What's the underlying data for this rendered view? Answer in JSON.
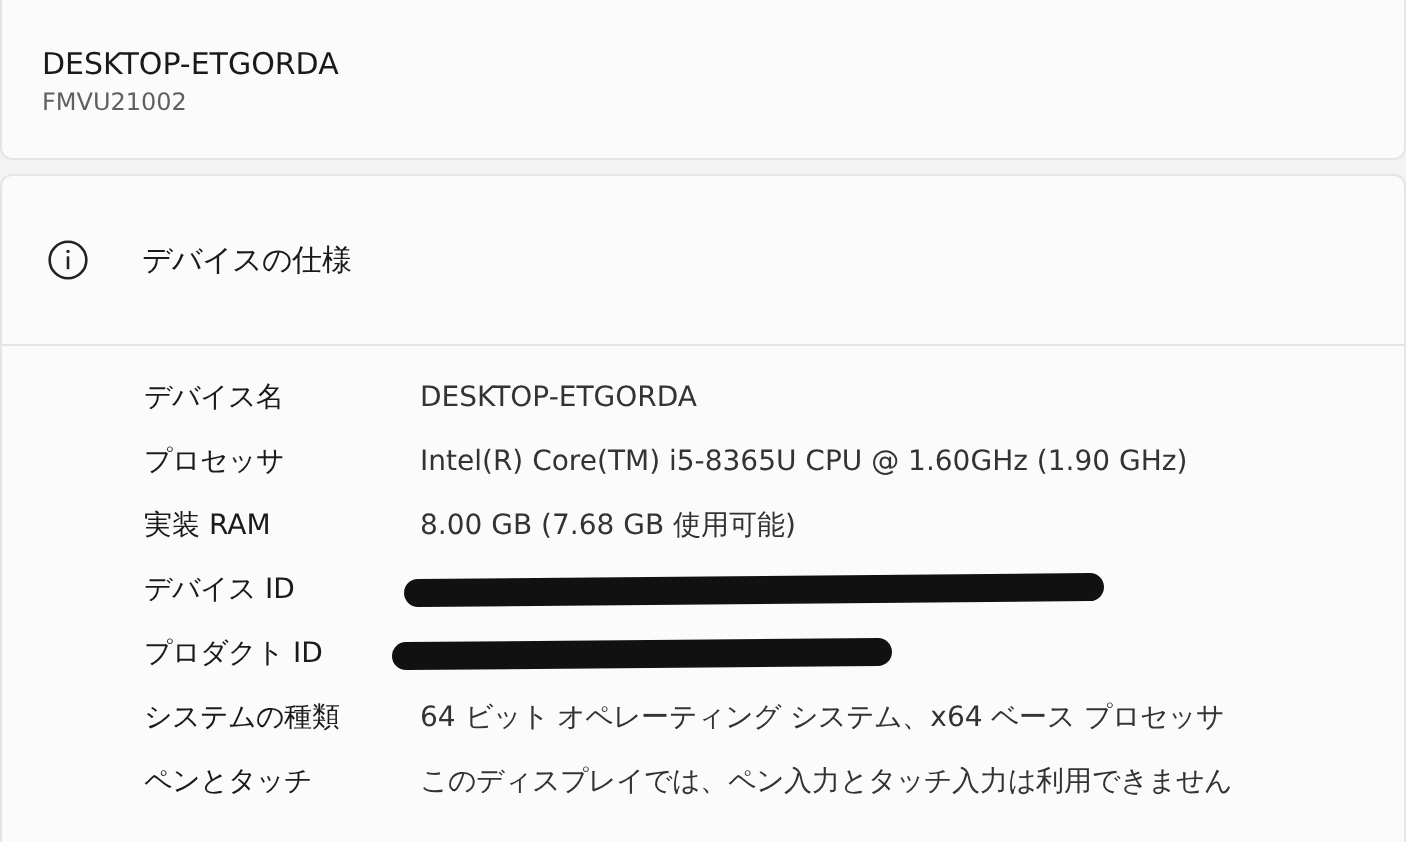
{
  "device": {
    "name": "DESKTOP-ETGORDA",
    "model": "FMVU21002"
  },
  "specs": {
    "title": "デバイスの仕様",
    "rows": [
      {
        "label": "デバイス名",
        "kind": "text",
        "value": "DESKTOP-ETGORDA"
      },
      {
        "label": "プロセッサ",
        "kind": "text",
        "value": "Intel(R) Core(TM) i5-8365U CPU @ 1.60GHz (1.90 GHz)"
      },
      {
        "label": "実装 RAM",
        "kind": "text",
        "value": "8.00 GB (7.68 GB 使用可能)"
      },
      {
        "label": "デバイス ID",
        "kind": "redacted"
      },
      {
        "label": "プロダクト ID",
        "kind": "redacted"
      },
      {
        "label": "システムの種類",
        "kind": "text",
        "value": "64 ビット オペレーティング システム、x64 ベース プロセッサ"
      },
      {
        "label": "ペンとタッチ",
        "kind": "text",
        "value": "このディスプレイでは、ペン入力とタッチ入力は利用できません"
      }
    ]
  }
}
